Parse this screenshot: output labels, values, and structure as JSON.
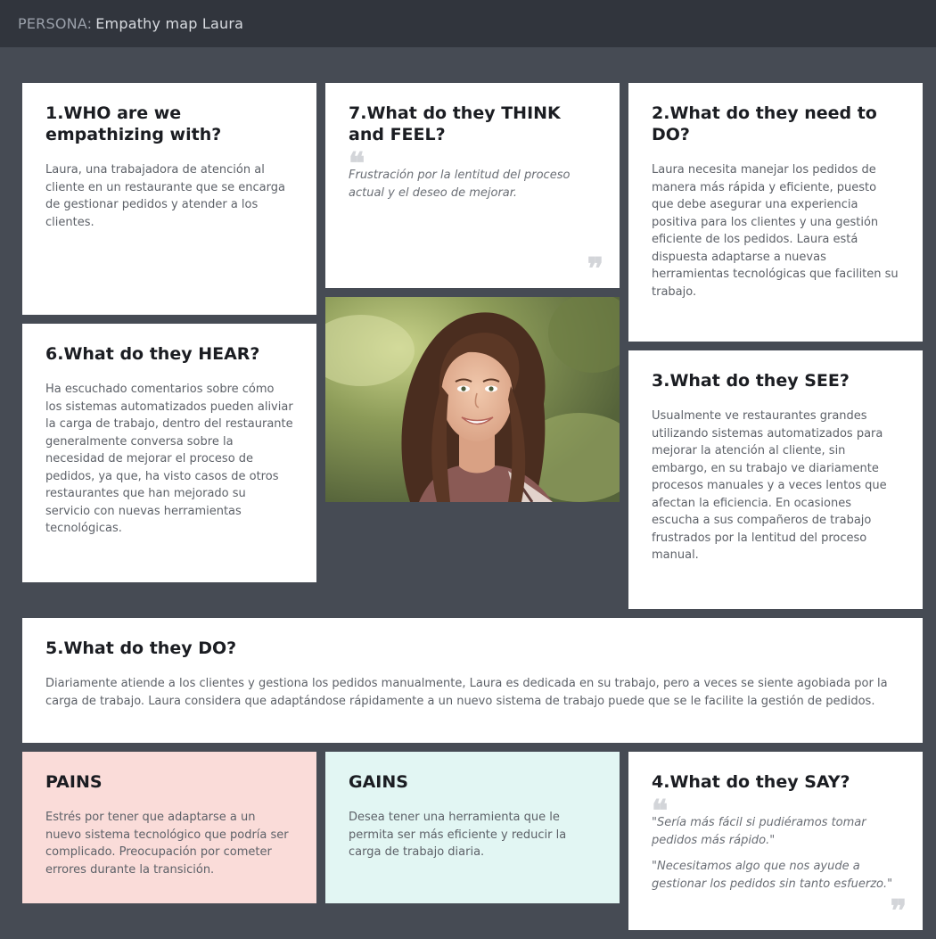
{
  "header": {
    "prefix": "PERSONA:",
    "title": "Empathy map Laura"
  },
  "cards": {
    "who": {
      "title": "1.WHO are we empathizing with?",
      "text": "Laura, una trabajadora de atención al cliente en un restaurante que se encarga de gestionar pedidos y atender a los clientes."
    },
    "think": {
      "title": "7.What do they THINK and FEEL?",
      "quote": "Frustración por la lentitud del proceso actual y el deseo de mejorar."
    },
    "need": {
      "title": "2.What do they need to DO?",
      "text": "Laura necesita manejar los pedidos de manera más rápida y eficiente, puesto que debe asegurar una experiencia positiva para los clientes y una gestión eficiente de los pedidos. Laura está dispuesta adaptarse a nuevas herramientas tecnológicas que faciliten su trabajo."
    },
    "hear": {
      "title": "6.What do they HEAR?",
      "text": "Ha escuchado comentarios sobre cómo los sistemas automatizados pueden aliviar la carga de trabajo, dentro del restaurante generalmente conversa sobre la necesidad de mejorar el proceso de pedidos, ya que, ha visto casos de otros restaurantes que han mejorado su servicio con nuevas herramientas tecnológicas."
    },
    "see": {
      "title": "3.What do they SEE?",
      "text": "Usualmente ve restaurantes grandes utilizando sistemas automatizados para mejorar la atención al cliente, sin embargo, en su trabajo ve diariamente procesos manuales y a veces lentos que afectan la eficiencia. En ocasiones escucha a sus compañeros de trabajo frustrados por la lentitud del proceso manual."
    },
    "do": {
      "title": "5.What do they DO?",
      "text": "Diariamente atiende a los clientes y gestiona los pedidos manualmente, Laura es dedicada en su trabajo, pero a veces se siente agobiada por la carga de trabajo. Laura considera que adaptándose rápidamente a un nuevo sistema de trabajo puede que se le facilite la gestión de pedidos."
    },
    "pains": {
      "title": "PAINS",
      "text": "Estrés por tener que adaptarse a un nuevo sistema tecnológico que podría ser complicado. Preocupación por cometer errores durante la transición."
    },
    "gains": {
      "title": "GAINS",
      "text": "Desea tener una herramienta que le permita ser más eficiente y reducir la carga de trabajo diaria."
    },
    "say": {
      "title": "4.What do they SAY?",
      "quotes": [
        "\"Sería más fácil si pudiéramos tomar pedidos más rápido.\"",
        "\"Necesitamos algo que nos ayude a gestionar los pedidos sin tanto esfuerzo.\""
      ]
    }
  },
  "glyphs": {
    "open_quote": "❝",
    "close_quote": "❞"
  },
  "colors": {
    "background": "#464b54",
    "header": "#31353d",
    "card": "#ffffff",
    "pains": "#fadcd9",
    "gains": "#e2f6f3"
  }
}
